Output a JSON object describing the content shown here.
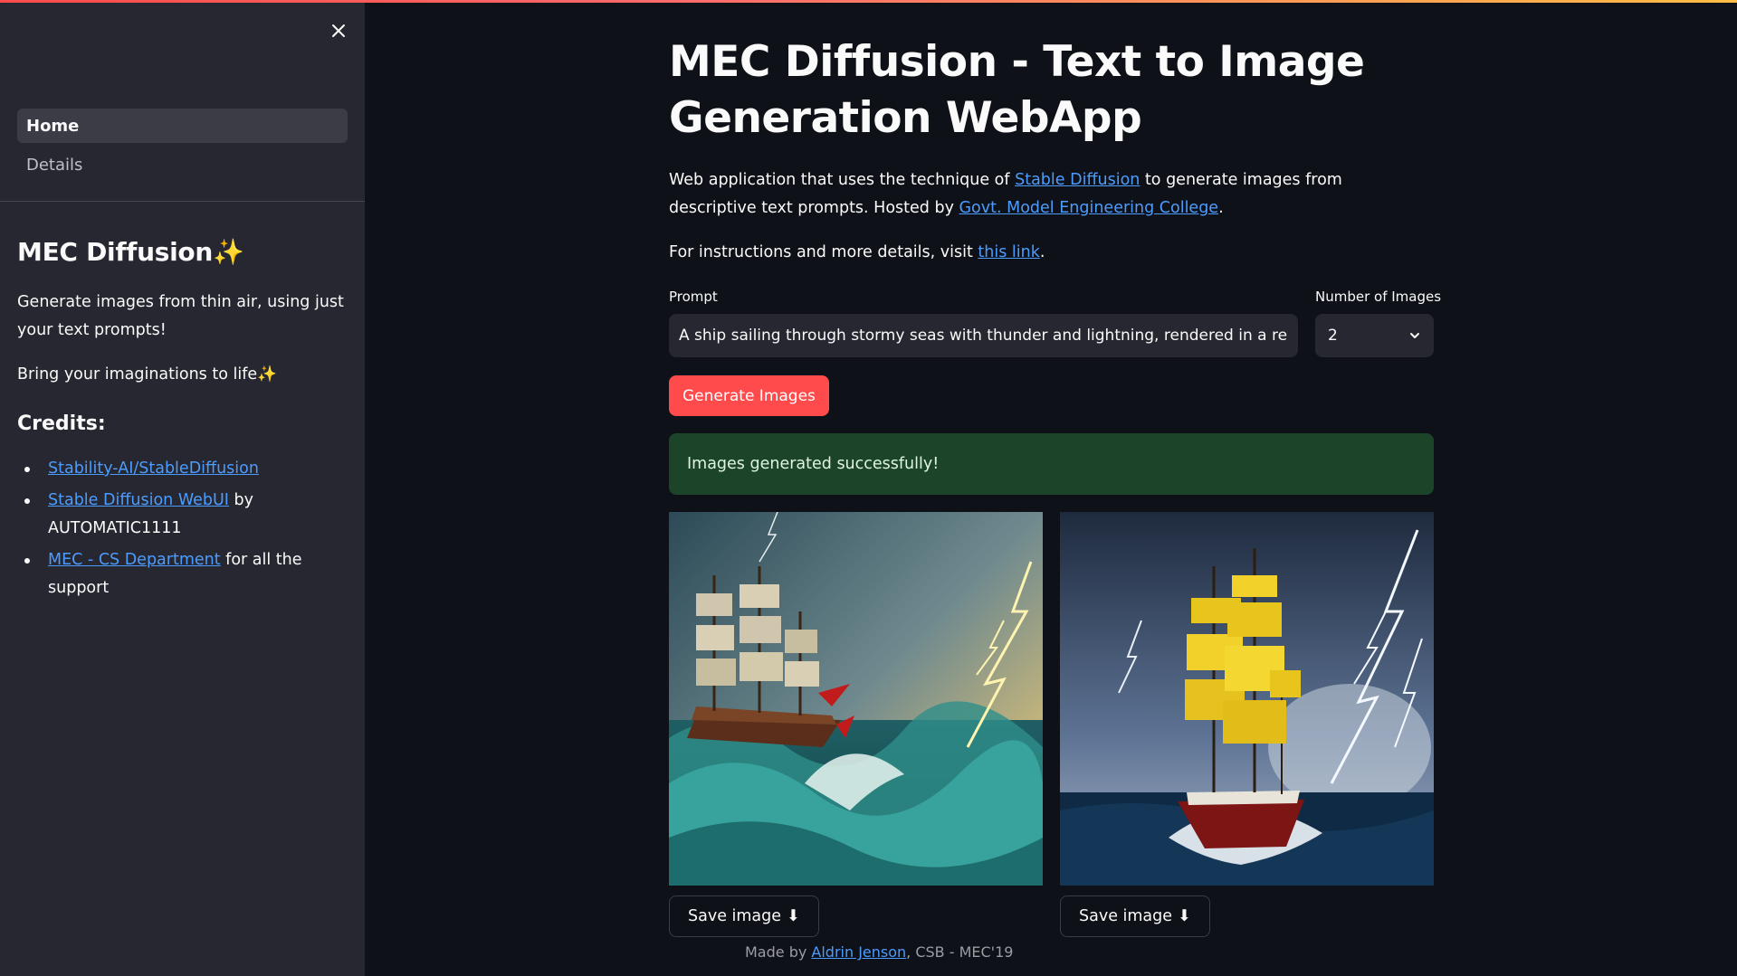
{
  "sidebar": {
    "nav": [
      {
        "label": "Home",
        "active": true
      },
      {
        "label": "Details",
        "active": false
      }
    ],
    "title": "MEC Diffusion",
    "title_emoji": "✨",
    "tagline": "Generate images from thin air, using just your text prompts!",
    "bring": "Bring your imaginations to life",
    "bring_emoji": "✨",
    "credits_heading": "Credits:",
    "credits": [
      {
        "link": "Stability-AI/StableDiffusion",
        "rest": ""
      },
      {
        "link": "Stable Diffusion WebUI",
        "rest": " by AUTOMATIC1111"
      },
      {
        "link": "MEC - CS Department",
        "rest": " for all the support"
      }
    ]
  },
  "main": {
    "title": "MEC Diffusion - Text to Image Generation WebApp",
    "desc_a": "Web application that uses the technique of ",
    "desc_link1": "Stable Diffusion",
    "desc_b": " to generate images from descriptive text prompts. Hosted by ",
    "desc_link2": "Govt. Model Engineering College",
    "desc_c": ".",
    "instr_a": "For instructions and more details, visit ",
    "instr_link": "this link",
    "instr_b": ".",
    "prompt_label": "Prompt",
    "prompt_value": "A ship sailing through stormy seas with thunder and lightning, rendered in a realistic",
    "num_label": "Number of Images",
    "num_value": "2",
    "generate_label": "Generate Images",
    "success_text": "Images generated successfully!",
    "save_label": "Save image",
    "save_icon": "⬇",
    "footer_a": "Made by ",
    "footer_link": "Aldrin Jenson",
    "footer_b": ", CSB - MEC'19"
  },
  "colors": {
    "accent": "#ff4b4b",
    "link": "#4c9cff",
    "success_bg": "#1c4428",
    "sidebar_bg": "#262730",
    "main_bg": "#0e1117"
  },
  "icons": {
    "close": "close-icon",
    "dropdown": "chevron-down-icon",
    "download": "download-icon"
  }
}
